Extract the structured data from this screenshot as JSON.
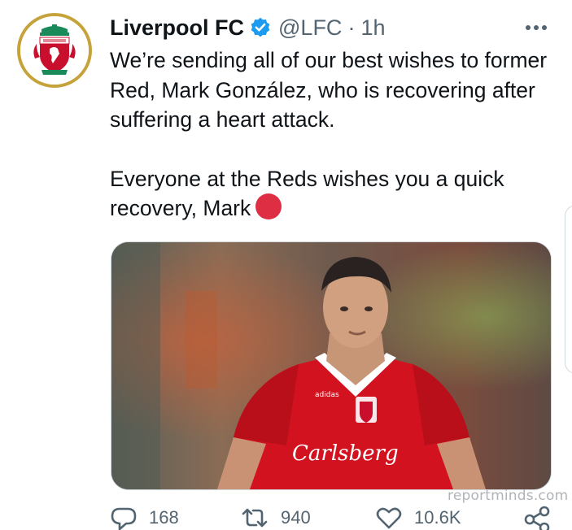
{
  "tweet": {
    "display_name": "Liverpool FC",
    "handle": "@LFC",
    "separator": "·",
    "time": "1h",
    "verified": true,
    "text_para1": "We’re sending all of our best wishes to former Red, Mark González, who is recovering after suffering a heart attack.",
    "text_para2": "Everyone at the Reds wishes you a quick recovery, Mark",
    "emoji": "red-circle",
    "media": {
      "shirt_brand": "adidas",
      "shirt_sponsor": "Carlsberg",
      "description_icon": "photo"
    }
  },
  "watermark": "reportminds.com",
  "actions": {
    "replies": "168",
    "retweets": "940",
    "likes": "10.6K"
  },
  "colors": {
    "text": "#0f1419",
    "secondary": "#536471",
    "verified": "#1d9bf0",
    "crest_gold": "#c6a23a",
    "crest_red": "#c8102e",
    "shirt_red": "#d3121f",
    "emoji_red": "#dd2e44"
  }
}
